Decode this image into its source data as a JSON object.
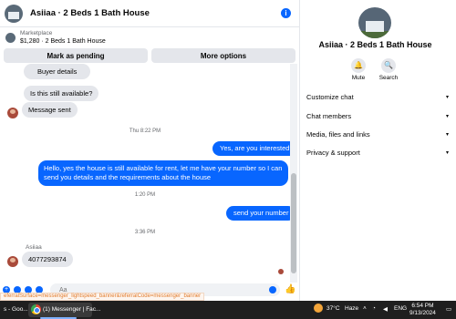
{
  "chat": {
    "title": "Asiiaa · 2 Beds 1 Bath House",
    "info_icon": "info-icon",
    "listing": {
      "source": "Marketplace",
      "name": "$1,280 · 2 Beds 1 Bath House"
    },
    "actions": {
      "pending": "Mark as pending",
      "more": "More options"
    },
    "messages": {
      "buyer_details": "Buyer details",
      "still_available": "Is this still available?",
      "message_sent": "Message sent",
      "time1": "Thu 8:22 PM",
      "reply1": "Yes, are you interested?",
      "reply2": "Hello, yes the house is still available for rent, let me have your number so I can send you details and the requirements about the house",
      "time2": "1:20 PM",
      "reply3": "send your number",
      "time3": "3:36 PM",
      "sender": "Asiiaa",
      "number": "4077293874"
    },
    "composer": {
      "placeholder": "Aa"
    },
    "status_url": "eferralSurface=messenger_lightspeed_banner&referralCode=messenger_banner"
  },
  "details": {
    "title": "Asiiaa · 2 Beds 1 Bath House",
    "mute": "Mute",
    "search": "Search",
    "rows": [
      "Customize chat",
      "Chat members",
      "Media, files and links",
      "Privacy & support"
    ]
  },
  "taskbar": {
    "item1": "s - Goo...",
    "item2": "(1) Messenger | Fac...",
    "temp": "37°C",
    "weather": "Haze",
    "lang": "ENG",
    "time": "6:54 PM",
    "date": "9/13/2024"
  },
  "colors": {
    "accent": "#0866ff",
    "bubble_in": "#e4e6eb",
    "taskbar": "#1f1f1f"
  }
}
